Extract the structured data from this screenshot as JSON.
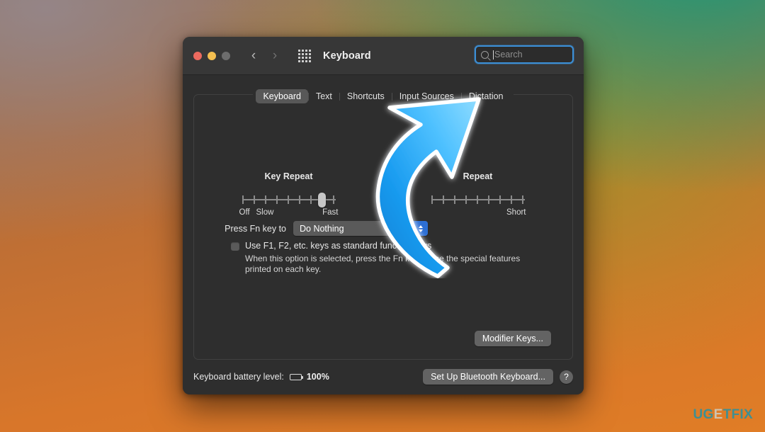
{
  "desktop": {
    "wallpaper_colors": [
      "#8c7a6c",
      "#bf6f34",
      "#d8762a",
      "#1c9678"
    ],
    "watermark": {
      "part1": "UG",
      "part2": "E",
      "part3": "TFIX",
      "color_teal": "#3f8f92",
      "color_light": "#cfc3ad"
    }
  },
  "window": {
    "title": "Keyboard",
    "traffic_lights": [
      {
        "name": "close",
        "color": "#ec6a5f"
      },
      {
        "name": "minimize",
        "color": "#f4bf50"
      },
      {
        "name": "zoom",
        "color": "#6d6d6d"
      }
    ],
    "nav": {
      "back": "‹",
      "forward": "›",
      "grid_icon": "grid-view-icon"
    },
    "search": {
      "placeholder": "Search",
      "value": "",
      "icon": "search-icon",
      "focus_color": "#3c8fd6"
    }
  },
  "tabs": [
    {
      "id": "keyboard",
      "label": "Keyboard",
      "active": true
    },
    {
      "id": "text",
      "label": "Text",
      "active": false
    },
    {
      "id": "shortcuts",
      "label": "Shortcuts",
      "active": false
    },
    {
      "id": "input-sources",
      "label": "Input Sources",
      "active": false
    },
    {
      "id": "dictation",
      "label": "Dictation",
      "active": false
    }
  ],
  "sliders": {
    "key_repeat": {
      "title": "Key Repeat",
      "labels": {
        "off": "Off",
        "slow": "Slow",
        "fast": "Fast"
      },
      "ticks": 9,
      "value_index": 7
    },
    "delay_until_repeat": {
      "title": "Repeat",
      "labels": {
        "short": "Short"
      },
      "ticks": 3,
      "note": "partially occluded by overlay arrow"
    }
  },
  "fn_row": {
    "label": "Press Fn key to",
    "selected": "Do Nothing",
    "chevron_color": "#2d6fd4"
  },
  "function_keys": {
    "checkbox_checked": false,
    "label": "Use F1, F2, etc. keys as standard function keys",
    "description": "When this option is selected, press the Fn key to use the special features printed on each key."
  },
  "buttons": {
    "modifier_keys": "Modifier Keys...",
    "set_up_bluetooth": "Set Up Bluetooth Keyboard...",
    "help": "?"
  },
  "footer": {
    "battery_label": "Keyboard battery level:",
    "battery_percent": "100%",
    "battery_icon": "battery-full-icon"
  },
  "overlay": {
    "arrow": {
      "name": "curved-arrow-annotation",
      "color": "#22a0f0",
      "points_to": "search-field"
    }
  }
}
